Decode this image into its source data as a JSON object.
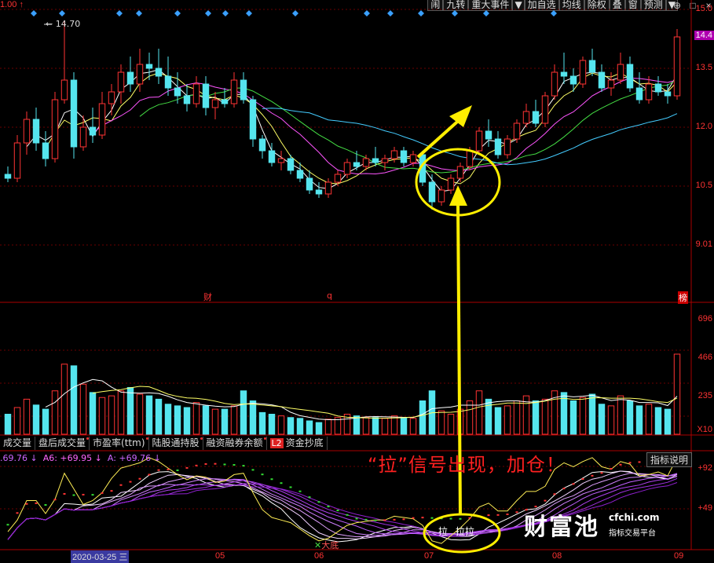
{
  "header": {
    "prev_close": "1.00",
    "toolbar": [
      "闹",
      "九转",
      "重大事件",
      "▼",
      "加自选",
      "均线",
      "除权",
      "叠",
      "窗",
      "预测",
      "▼"
    ],
    "window_controls": [
      "⊕",
      "□",
      "×"
    ]
  },
  "price_axis": {
    "labels": [
      "15.0",
      "14.4",
      "13.5",
      "12.0",
      "10.5",
      "9.01"
    ],
    "current": "14.4"
  },
  "max_marker": "14.70",
  "event_markers": {
    "cai": "财",
    "q": "q",
    "bang": "榜"
  },
  "volume_axis": {
    "labels": [
      "696",
      "466",
      "235",
      "X10"
    ]
  },
  "indicator_tabs": [
    {
      "label": "成交量"
    },
    {
      "label": "盘后成交量"
    },
    {
      "label": "市盈率(ttm)"
    },
    {
      "label": "陆股通持股"
    },
    {
      "label": "融资融券余额"
    },
    {
      "label": "资金抄底",
      "badge": "L2"
    }
  ],
  "indicator_legend": {
    "a": ".69.76 ↓",
    "a6": "A6: +69.95 ↓",
    "a_main": "A: +69.76 ↓"
  },
  "explain_button": "指标说明",
  "indicator_axis": {
    "labels": [
      "+92",
      "+49"
    ]
  },
  "date_axis": {
    "highlight": "2020-03-25 三",
    "months": [
      "05",
      "06",
      "07",
      "08",
      "09"
    ]
  },
  "annotation": {
    "signal_text": "“拉”信号出现，加仓！",
    "la_labels": [
      "拉",
      "拉拉"
    ],
    "bottom_label": "大底"
  },
  "brand": {
    "logo": "财富池",
    "site": "cfchi.com",
    "slogan": "指标交易平台"
  },
  "colors": {
    "up": "#ff3333",
    "down": "#55e5ee",
    "highlight": "#ffee00",
    "ma5": "#ffffff",
    "ma10": "#ffff66",
    "ma20": "#ff55ff",
    "ma30": "#44dd44",
    "ma60": "#44ccff"
  },
  "chart_data": {
    "type": "candlestick",
    "ylim": [
      9.0,
      15.0
    ],
    "candles": [
      [
        10.8,
        11.0,
        10.6,
        10.7
      ],
      [
        10.7,
        11.8,
        10.6,
        11.6
      ],
      [
        11.6,
        12.4,
        11.3,
        12.2
      ],
      [
        12.2,
        12.5,
        11.4,
        11.6
      ],
      [
        11.6,
        11.9,
        11.0,
        11.2
      ],
      [
        11.2,
        12.9,
        11.1,
        12.7
      ],
      [
        12.7,
        14.7,
        12.6,
        13.2
      ],
      [
        13.2,
        13.4,
        11.2,
        11.5
      ],
      [
        11.5,
        12.3,
        11.4,
        12.0
      ],
      [
        12.0,
        12.5,
        11.6,
        11.8
      ],
      [
        11.8,
        12.9,
        11.7,
        12.6
      ],
      [
        12.6,
        13.1,
        12.3,
        12.9
      ],
      [
        12.9,
        13.6,
        12.6,
        13.4
      ],
      [
        13.4,
        13.8,
        12.9,
        13.1
      ],
      [
        13.1,
        14.0,
        12.9,
        13.6
      ],
      [
        13.6,
        13.9,
        13.2,
        13.5
      ],
      [
        13.5,
        14.0,
        13.1,
        13.3
      ],
      [
        13.3,
        13.8,
        12.8,
        13.0
      ],
      [
        13.0,
        13.4,
        12.6,
        12.8
      ],
      [
        12.8,
        13.1,
        12.4,
        12.6
      ],
      [
        12.6,
        13.3,
        12.5,
        13.1
      ],
      [
        13.1,
        13.3,
        12.3,
        12.5
      ],
      [
        12.5,
        12.9,
        12.2,
        12.7
      ],
      [
        12.7,
        13.0,
        12.5,
        12.6
      ],
      [
        12.6,
        13.4,
        12.5,
        13.2
      ],
      [
        13.2,
        13.4,
        12.6,
        12.7
      ],
      [
        12.7,
        12.8,
        11.5,
        11.7
      ],
      [
        11.7,
        11.8,
        11.2,
        11.4
      ],
      [
        11.4,
        11.6,
        11.0,
        11.1
      ],
      [
        11.1,
        11.4,
        10.9,
        11.2
      ],
      [
        11.2,
        11.3,
        10.8,
        10.9
      ],
      [
        10.9,
        11.1,
        10.6,
        10.7
      ],
      [
        10.7,
        10.9,
        10.3,
        10.4
      ],
      [
        10.4,
        10.6,
        10.2,
        10.3
      ],
      [
        10.3,
        10.7,
        10.2,
        10.6
      ],
      [
        10.6,
        10.9,
        10.5,
        10.8
      ],
      [
        10.8,
        11.2,
        10.7,
        11.1
      ],
      [
        11.1,
        11.4,
        10.9,
        11.0
      ],
      [
        11.0,
        11.3,
        10.9,
        11.2
      ],
      [
        11.2,
        11.5,
        11.0,
        11.1
      ],
      [
        11.1,
        11.3,
        10.9,
        11.2
      ],
      [
        11.2,
        11.5,
        11.1,
        11.4
      ],
      [
        11.4,
        11.5,
        11.0,
        11.1
      ],
      [
        11.1,
        11.4,
        11.0,
        11.3
      ],
      [
        11.3,
        11.4,
        10.5,
        10.6
      ],
      [
        10.6,
        10.8,
        9.9,
        10.1
      ],
      [
        10.1,
        10.5,
        10.0,
        10.4
      ],
      [
        10.4,
        10.8,
        10.3,
        10.7
      ],
      [
        10.7,
        11.1,
        10.6,
        11.0
      ],
      [
        11.0,
        11.5,
        10.9,
        11.4
      ],
      [
        11.4,
        12.0,
        11.3,
        11.9
      ],
      [
        11.9,
        12.2,
        11.5,
        11.7
      ],
      [
        11.7,
        11.9,
        11.2,
        11.3
      ],
      [
        11.3,
        11.8,
        11.2,
        11.7
      ],
      [
        11.7,
        12.2,
        11.6,
        12.1
      ],
      [
        12.1,
        12.6,
        12.0,
        12.4
      ],
      [
        12.4,
        12.7,
        12.0,
        12.1
      ],
      [
        12.1,
        12.9,
        12.0,
        12.8
      ],
      [
        12.8,
        13.6,
        12.7,
        13.4
      ],
      [
        13.4,
        13.9,
        13.1,
        13.3
      ],
      [
        13.3,
        13.5,
        12.9,
        13.1
      ],
      [
        13.1,
        13.8,
        13.0,
        13.7
      ],
      [
        13.7,
        14.0,
        13.3,
        13.4
      ],
      [
        13.4,
        13.6,
        12.9,
        13.0
      ],
      [
        13.0,
        13.4,
        12.8,
        13.2
      ],
      [
        13.2,
        13.9,
        13.1,
        13.6
      ],
      [
        13.6,
        13.8,
        12.9,
        13.0
      ],
      [
        13.0,
        13.4,
        12.6,
        12.7
      ],
      [
        12.7,
        13.3,
        12.6,
        13.1
      ],
      [
        13.1,
        13.3,
        12.8,
        12.9
      ],
      [
        12.9,
        13.1,
        12.6,
        12.8
      ],
      [
        12.8,
        14.5,
        12.7,
        14.3
      ]
    ],
    "volume": [
      120,
      160,
      210,
      175,
      150,
      260,
      420,
      410,
      300,
      250,
      220,
      230,
      260,
      280,
      240,
      230,
      210,
      180,
      170,
      160,
      190,
      170,
      150,
      150,
      170,
      260,
      200,
      130,
      120,
      110,
      100,
      95,
      80,
      70,
      90,
      100,
      120,
      110,
      100,
      100,
      95,
      110,
      100,
      95,
      200,
      260,
      140,
      120,
      150,
      200,
      260,
      210,
      160,
      170,
      200,
      230,
      200,
      210,
      260,
      250,
      200,
      220,
      240,
      180,
      170,
      230,
      200,
      170,
      180,
      160,
      150,
      480
    ]
  }
}
